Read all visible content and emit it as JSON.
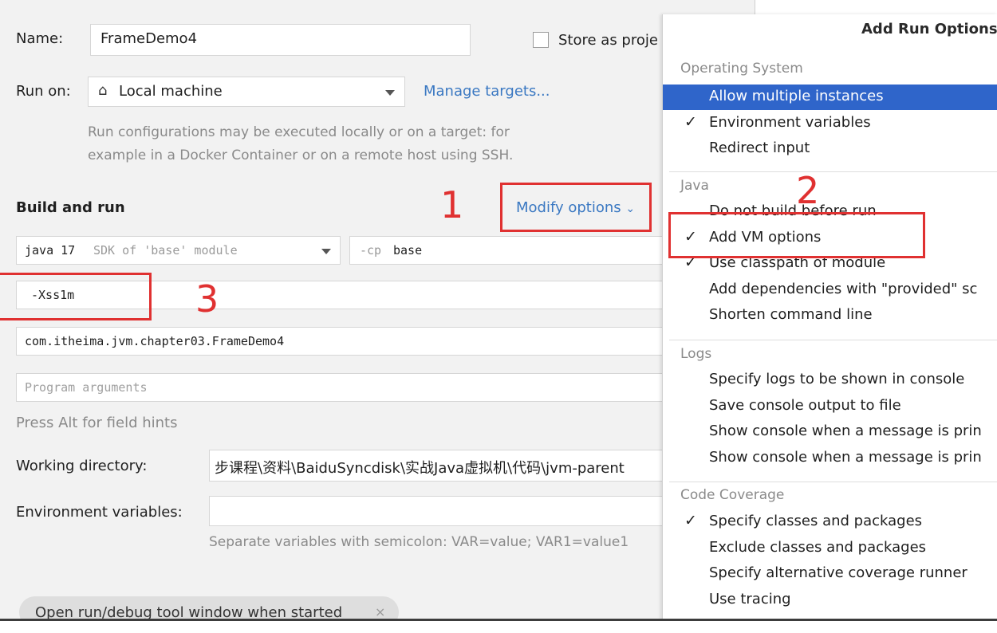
{
  "form": {
    "name_label": "Name:",
    "name_value": "FrameDemo4",
    "store_label": "Store as proje",
    "run_on_label": "Run on:",
    "run_on_value": "Local machine",
    "manage_targets": "Manage targets...",
    "run_hint_line1": "Run configurations may be executed locally or on a target: for",
    "run_hint_line2": "example in a Docker Container or on a remote host using SSH.",
    "build_and_run": "Build and run",
    "modify_options": "Modify options",
    "jdk_name": "java 17",
    "jdk_detail": "SDK of 'base' module",
    "cp_prefix": "-cp",
    "cp_value": "base",
    "vm_options": "-Xss1m",
    "main_class": "com.itheima.jvm.chapter03.FrameDemo4",
    "program_args_placeholder": "Program arguments",
    "alt_hint": "Press Alt for field hints",
    "working_dir_label": "Working directory:",
    "working_dir_value": "步课程\\资料\\BaiduSyncdisk\\实战Java虚拟机\\代码\\jvm-parent",
    "env_label": "Environment variables:",
    "env_hint": "Separate variables with semicolon: VAR=value; VAR1=value1",
    "open_tool_window": "Open run/debug tool window when started"
  },
  "annotations": {
    "n1": "1",
    "n2": "2",
    "n3": "3"
  },
  "popup": {
    "title": "Add Run Options",
    "sections": {
      "os": "Operating System",
      "java": "Java",
      "logs": "Logs",
      "coverage": "Code Coverage"
    },
    "os_items": [
      {
        "label": "Allow multiple instances",
        "checked": false,
        "selected": true
      },
      {
        "label": "Environment variables",
        "checked": true
      },
      {
        "label": "Redirect input",
        "checked": false
      }
    ],
    "java_items": [
      {
        "label": "Do not build before run",
        "checked": false
      },
      {
        "label": "Add VM options",
        "checked": true
      },
      {
        "label": "Use classpath of module",
        "checked": true
      },
      {
        "label": "Add dependencies with \"provided\" sc",
        "checked": false
      },
      {
        "label": "Shorten command line",
        "checked": false
      }
    ],
    "logs_items": [
      {
        "label": "Specify logs to be shown in console",
        "checked": false
      },
      {
        "label": "Save console output to file",
        "checked": false
      },
      {
        "label": "Show console when a message is prin",
        "checked": false
      },
      {
        "label": "Show console when a message is prin",
        "checked": false
      }
    ],
    "coverage_items": [
      {
        "label": "Specify classes and packages",
        "checked": true
      },
      {
        "label": "Exclude classes and packages",
        "checked": false
      },
      {
        "label": "Specify alternative coverage runner",
        "checked": false
      },
      {
        "label": "Use tracing",
        "checked": false
      }
    ],
    "check_glyph": "✓"
  },
  "colors": {
    "annotation_red": "#e03131",
    "selection_blue": "#2f65ca",
    "link_blue": "#3a78c2"
  }
}
